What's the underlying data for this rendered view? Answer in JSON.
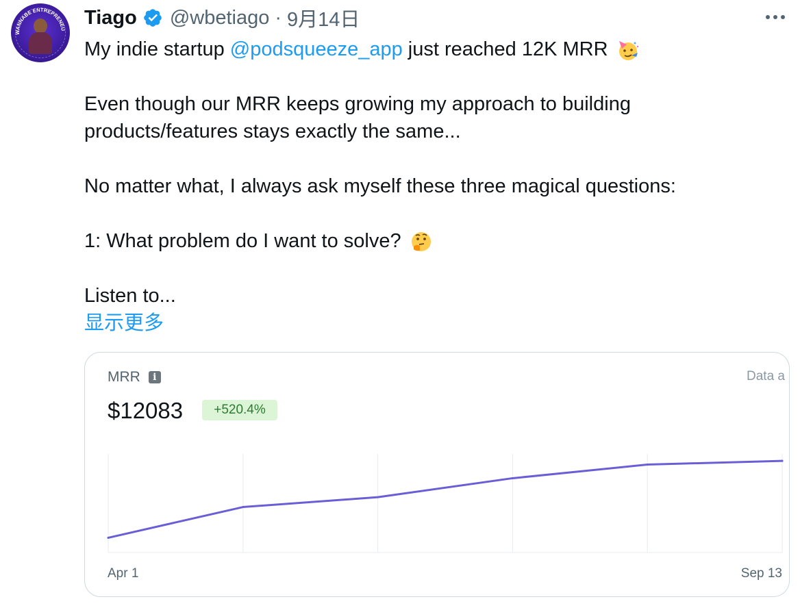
{
  "tweet": {
    "author_name": "Tiago",
    "handle": "@wbetiago",
    "separator": "·",
    "timestamp": "9月14日",
    "more_icon": "ellipsis-icon",
    "avatar_arc_text": "WANNABE ENTREPRENEUR",
    "body": {
      "line1_pre": "My indie startup ",
      "line1_mention": "@podsqueeze_app",
      "line1_post": " just reached 12K MRR",
      "line2": "Even though our MRR keeps growing my approach to building",
      "line3": "products/features stays exactly the same...",
      "line4": "No matter what, I always ask myself these three magical questions:",
      "line5": "1: What problem do I want to solve?",
      "line6": "Listen to...",
      "show_more": "显示更多"
    },
    "colors": {
      "link": "#1d9bf0",
      "verified": "#1d9bf0",
      "line": "#6a5ed6"
    }
  },
  "card": {
    "label": "MRR",
    "info_icon": "info-icon",
    "data_as_of": "Data a",
    "value": "$12083",
    "change_badge": "+520.4%",
    "x_start_label": "Apr 1",
    "x_end_label": "Sep 13"
  },
  "chart_data": {
    "type": "line",
    "x": [
      "Apr 1",
      "",
      "",
      "",
      "",
      "Sep 13"
    ],
    "series": [
      {
        "values": [
          1950,
          6000,
          7300,
          9800,
          11600,
          12083
        ]
      }
    ],
    "ylim": [
      0,
      13000
    ],
    "grid": "vertical"
  }
}
